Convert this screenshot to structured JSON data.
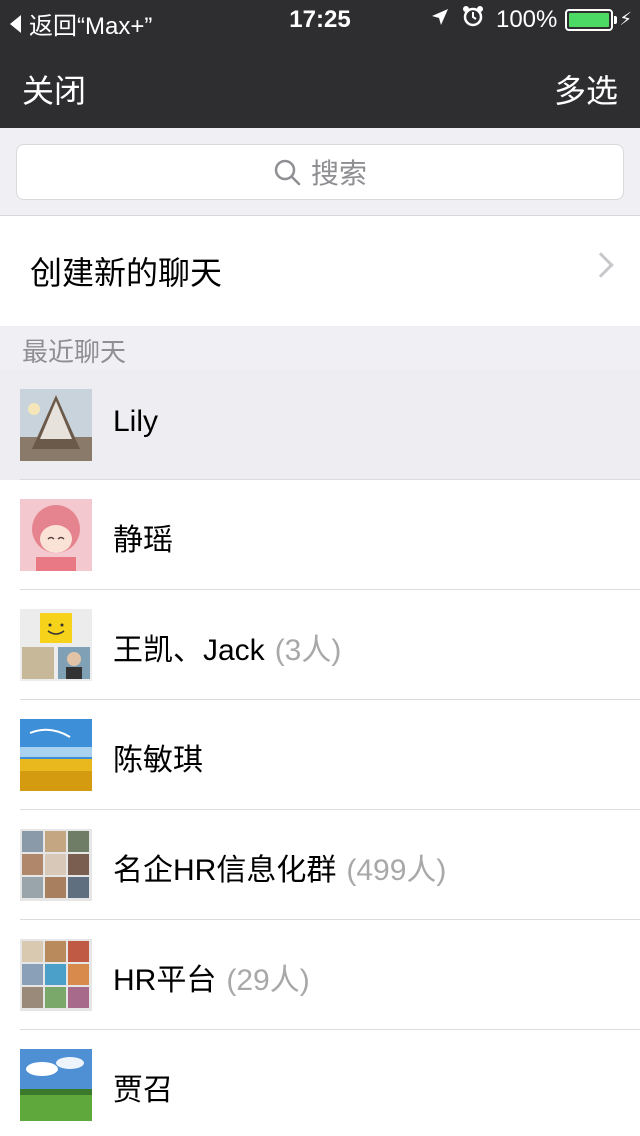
{
  "status_bar": {
    "back_text": "返回“Max+”",
    "time": "17:25",
    "battery": "100%"
  },
  "nav": {
    "left": "关闭",
    "right": "多选"
  },
  "search": {
    "placeholder": "搜索"
  },
  "create": {
    "label": "创建新的聊天"
  },
  "section": {
    "title": "最近聊天"
  },
  "chats": [
    {
      "name": "Lily",
      "count": ""
    },
    {
      "name": "静瑶",
      "count": ""
    },
    {
      "name": "王凯、Jack",
      "count": "(3人)"
    },
    {
      "name": "陈敏琪",
      "count": ""
    },
    {
      "name": "名企HR信息化群",
      "count": "(499人)"
    },
    {
      "name": "HR平台",
      "count": "(29人)"
    },
    {
      "name": "贾召",
      "count": ""
    }
  ],
  "colors": {
    "bar": "#2e2e31",
    "battery": "#4cd964",
    "background": "#efeff4"
  }
}
